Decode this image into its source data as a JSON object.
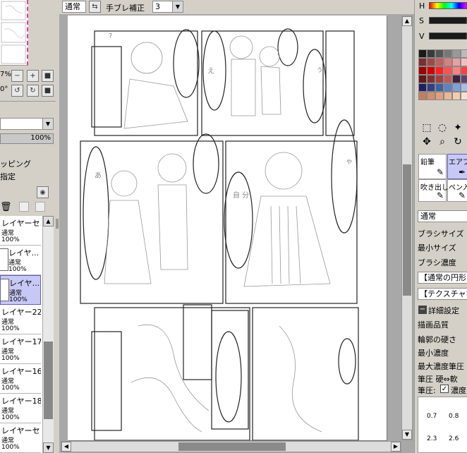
{
  "toolbar": {
    "blend_mode": "通常",
    "stabilizer_label": "手ブレ補正",
    "stabilizer_value": "3"
  },
  "left": {
    "zoom_pct_partial": "7%",
    "angle_partial": "0°",
    "opacity_value": "100%",
    "clipping_label": "ッピング",
    "selection_label": "指定",
    "layers": [
      {
        "name": "レイヤーセ...",
        "mode": "通常",
        "opacity": "100%"
      },
      {
        "name": "レイヤ...",
        "mode": "通常",
        "opacity": "100%"
      },
      {
        "name": "レイヤ...",
        "mode": "通常",
        "opacity": "100%"
      },
      {
        "name": "レイヤー22",
        "mode": "通常",
        "opacity": "100%"
      },
      {
        "name": "レイヤー17",
        "mode": "通常",
        "opacity": "100%"
      },
      {
        "name": "レイヤー16",
        "mode": "通常",
        "opacity": "100%"
      },
      {
        "name": "レイヤー18",
        "mode": "通常",
        "opacity": "100%"
      },
      {
        "name": "レイヤーセッ...",
        "mode": "通常",
        "opacity": "100%"
      }
    ]
  },
  "right": {
    "hsv": {
      "h": "H",
      "s": "S",
      "v": "V"
    },
    "palette": [
      "#1a1a1a",
      "#3a3a3a",
      "#555555",
      "#777777",
      "#999999",
      "#bbbbbb",
      "#dddddd",
      "#f4f4f4",
      "#7a3030",
      "#a04848",
      "#c06060",
      "#d88080",
      "#e8a0a0",
      "#f0c0c0",
      "#f8dede",
      "#ffeeee",
      "#a00000",
      "#d00000",
      "#ff2020",
      "#ff5050",
      "#ff8080",
      "#ff4040",
      "#e04040",
      "#ff2a2a",
      "#601818",
      "#803030",
      "#a04040",
      "#c05858",
      "#402040",
      "#604070",
      "#806090",
      "#a080b0",
      "#202060",
      "#304080",
      "#4060a0",
      "#6080c0",
      "#80a0d8",
      "#a0c0e8",
      "#c0d8f0",
      "#e0ecf8",
      "#c08060",
      "#d09070",
      "#e0a080",
      "#e8b898",
      "#f0ccb0",
      "#f8e0d0",
      "#fff0e8",
      "#ffffff"
    ],
    "tool_pencil": "鉛筆",
    "tool_airbrush": "エアブラ",
    "tool_balloon": "吹き出し",
    "tool_pen": "ペン入",
    "brush_mode": "通常",
    "brush_size": "ブラシサイズ",
    "min_size": "最小サイズ",
    "brush_density": "ブラシ濃度",
    "shape_select": "【通常の円形",
    "texture_select": "【テクスチャなし",
    "detail_setting": "詳細設定",
    "quality": "描画品質",
    "edge_hardness": "輪郭の硬さ",
    "min_density": "最小濃度",
    "max_density_pressure": "最大濃度筆圧",
    "pressure_hard_soft": "筆圧 硬⇔軟",
    "pressure_label": "筆圧:",
    "pressure_density": "濃度",
    "sizes": [
      "0.7",
      "0.8",
      "2.3",
      "2.6"
    ]
  },
  "canvas": {
    "bubble_texts": [
      "あ",
      "え",
      "ぅ",
      "ゃ",
      "自 分"
    ]
  }
}
